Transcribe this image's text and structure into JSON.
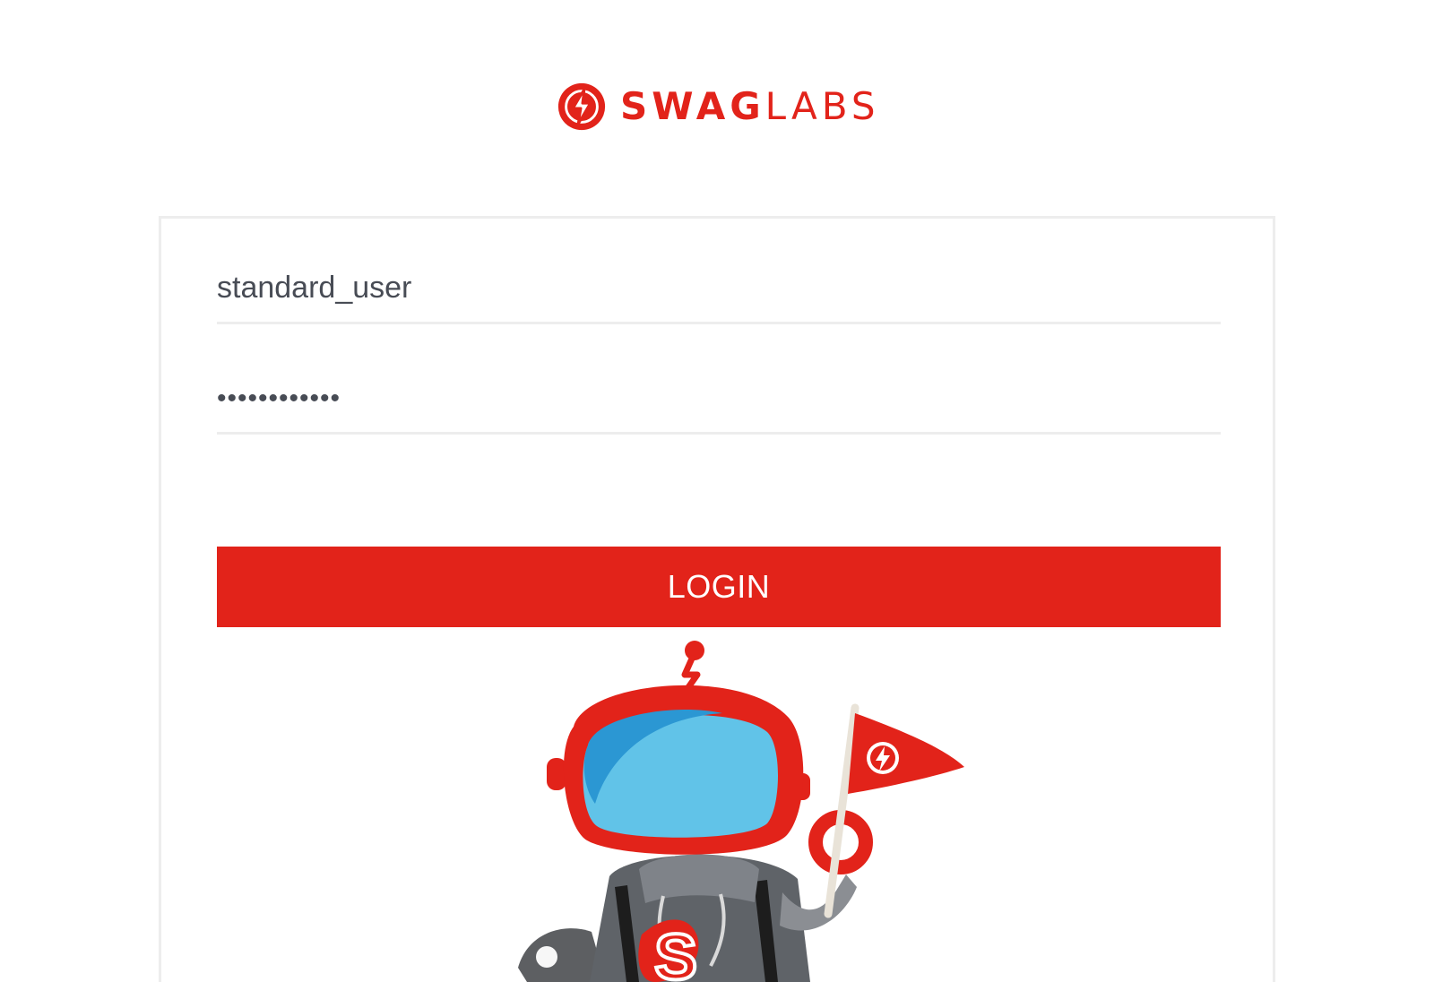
{
  "header": {
    "logo_icon": "lightning-bolt-circle-icon",
    "logo_text_bold": "SWAG",
    "logo_text_light": "LABS",
    "brand_color": "#e2231a"
  },
  "login": {
    "username_value": "standard_user",
    "password_value": "••••••••••••",
    "button_label": "LOGIN"
  },
  "illustration": {
    "name": "robot-mascot-with-flag"
  }
}
